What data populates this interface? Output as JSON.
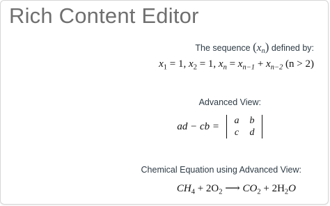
{
  "editor": {
    "title": "Rich Content Editor"
  },
  "sequence": {
    "caption_prefix": "The sequence ",
    "caption_suffix": " defined by:",
    "x_symbol": "x",
    "n_subscript": "n",
    "formula": {
      "x1": "x",
      "x1_sub": "1",
      "v1": " = 1, ",
      "x2": "x",
      "x2_sub": "2",
      "v2": " = 1, ",
      "xn": "x",
      "xn_sub": "n",
      "eq": " = ",
      "xa": "x",
      "xa_sub": "n−1",
      "plus": " + ",
      "xb": "x",
      "xb_sub": "n−2",
      "cond": " (n > 2)"
    }
  },
  "advanced": {
    "caption": "Advanced View:",
    "lhs": "ad − cb =",
    "matrix": [
      "a",
      "b",
      "c",
      "d"
    ]
  },
  "chemical": {
    "caption": "Chemical Equation using Advanced View:",
    "ch": "CH",
    "ch_sub": "4",
    "plus1": " + 2O",
    "o_sub": "2",
    "arrow": " ⟶ ",
    "co": "CO",
    "co_sub": "2",
    "plus2": " + 2H",
    "h_sub": "2",
    "o": "O"
  }
}
